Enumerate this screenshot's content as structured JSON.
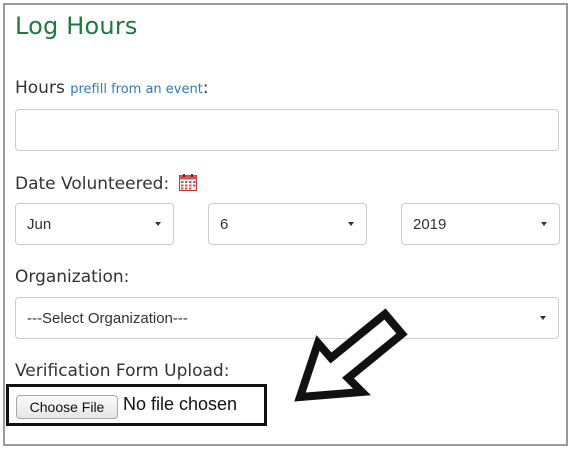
{
  "page": {
    "title": "Log Hours"
  },
  "hours": {
    "label": "Hours",
    "prefill_link": "prefill from an event",
    "label_suffix": ":",
    "value": ""
  },
  "date": {
    "label": "Date Volunteered:",
    "calendar_icon": "calendar-icon",
    "month": "Jun",
    "day": "6",
    "year": "2019"
  },
  "organization": {
    "label": "Organization:",
    "selected": "---Select Organization---"
  },
  "upload": {
    "label": "Verification Form Upload:",
    "button_label": "Choose File",
    "status": "No file chosen"
  },
  "annotation": {
    "arrow_icon": "arrow-pointer-icon"
  },
  "colors": {
    "title": "#1f7a3e",
    "link": "#2f7bbf",
    "border": "#cccccc"
  }
}
